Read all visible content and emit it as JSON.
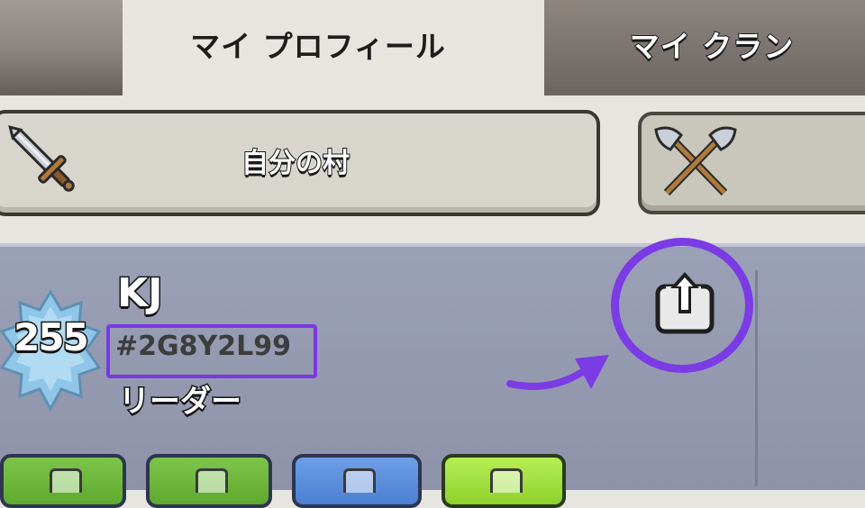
{
  "tabs": {
    "my_profile": "マイ プロフィール",
    "my_clan": "マイ クラン"
  },
  "subtabs": {
    "home_village": "自分の村"
  },
  "profile": {
    "level": "255",
    "name": "KJ",
    "tag": "#2G8Y2L99",
    "role": "リーダー"
  },
  "icons": {
    "sword": "sword-icon",
    "axes": "crossed-axes-icon",
    "share": "share-icon",
    "level_badge": "star-badge-icon"
  },
  "colors": {
    "highlight": "#7b3be5",
    "panel": "#9aa0b6",
    "tab_active": "#e6e5df"
  }
}
